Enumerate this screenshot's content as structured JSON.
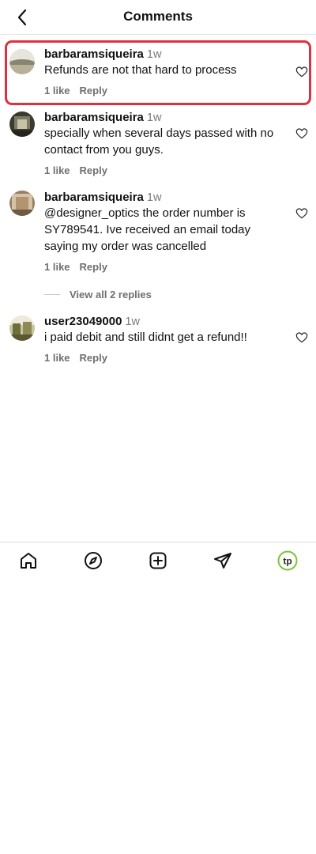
{
  "header": {
    "title": "Comments"
  },
  "comments": [
    {
      "username": "barbaramsiqueira",
      "time": "1w",
      "text": "Refunds are not that hard to process",
      "likes": "1 like",
      "reply": "Reply"
    },
    {
      "username": "barbaramsiqueira",
      "time": "1w",
      "text": "specially when several days passed with no contact from you guys.",
      "likes": "1 like",
      "reply": "Reply"
    },
    {
      "username": "barbaramsiqueira",
      "time": "1w",
      "text": "@designer_optics the order number is SY789541. Ive received an email today saying my order was cancelled",
      "likes": "1 like",
      "reply": "Reply",
      "view_replies": "View all 2 replies"
    },
    {
      "username": "user23049000",
      "time": "1w",
      "text": "i paid debit and still didnt get a refund!!",
      "likes": "1 like",
      "reply": "Reply"
    }
  ],
  "tabbar": {
    "icons": [
      "home-icon",
      "explore-icon",
      "new-post-icon",
      "direct-icon",
      "profile-icon"
    ],
    "profile_initials": "tp",
    "profile_color": "#7cc43a"
  },
  "colors": {
    "highlight": "#e0303f"
  }
}
